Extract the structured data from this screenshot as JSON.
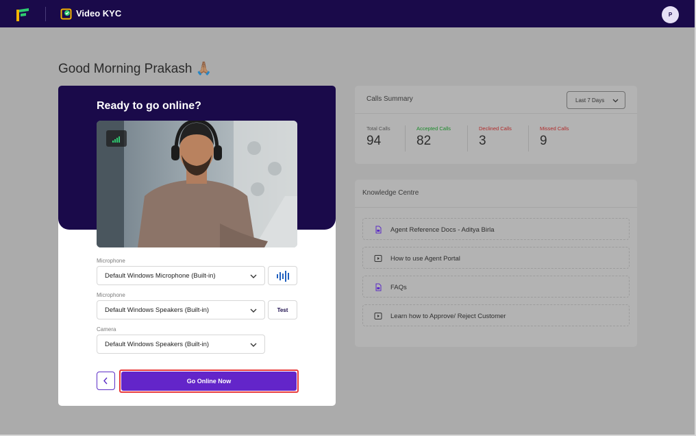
{
  "header": {
    "app_title": "Video KYC",
    "avatar_initial": "P"
  },
  "greeting": "Good Morning Prakash 🙏🏽",
  "online_panel": {
    "title": "Ready to go online?",
    "fields": [
      {
        "label": "Microphone",
        "value": "Default Windows Microphone (Built-in)"
      },
      {
        "label": "Microphone",
        "value": "Default Windows Speakers (Built-in)"
      },
      {
        "label": "Camera",
        "value": "Default Windows Speakers (Built-in)"
      }
    ],
    "test_label": "Test",
    "go_online_label": "Go Online Now"
  },
  "calls_summary": {
    "title": "Calls Summary",
    "range": "Last 7 Days",
    "stats": [
      {
        "label": "Total Calls",
        "value": "94",
        "color": "#555555"
      },
      {
        "label": "Accepted Calls",
        "value": "82",
        "color": "#1a8a2a"
      },
      {
        "label": "Declined Calls",
        "value": "3",
        "color": "#b02a2a"
      },
      {
        "label": "Missed Calls",
        "value": "9",
        "color": "#b02a2a"
      }
    ]
  },
  "knowledge_centre": {
    "title": "Knowledge Centre",
    "items": [
      {
        "label": "Agent Reference Docs - Aditya Birla",
        "icon": "document-icon"
      },
      {
        "label": "How to use Agent Portal",
        "icon": "video-play-icon"
      },
      {
        "label": "FAQs",
        "icon": "document-icon"
      },
      {
        "label": "Learn how to Approve/ Reject Customer",
        "icon": "video-play-icon"
      }
    ]
  },
  "colors": {
    "brand_dark": "#1a0a4a",
    "primary_button": "#6325c9",
    "highlight": "#e83a3a"
  }
}
